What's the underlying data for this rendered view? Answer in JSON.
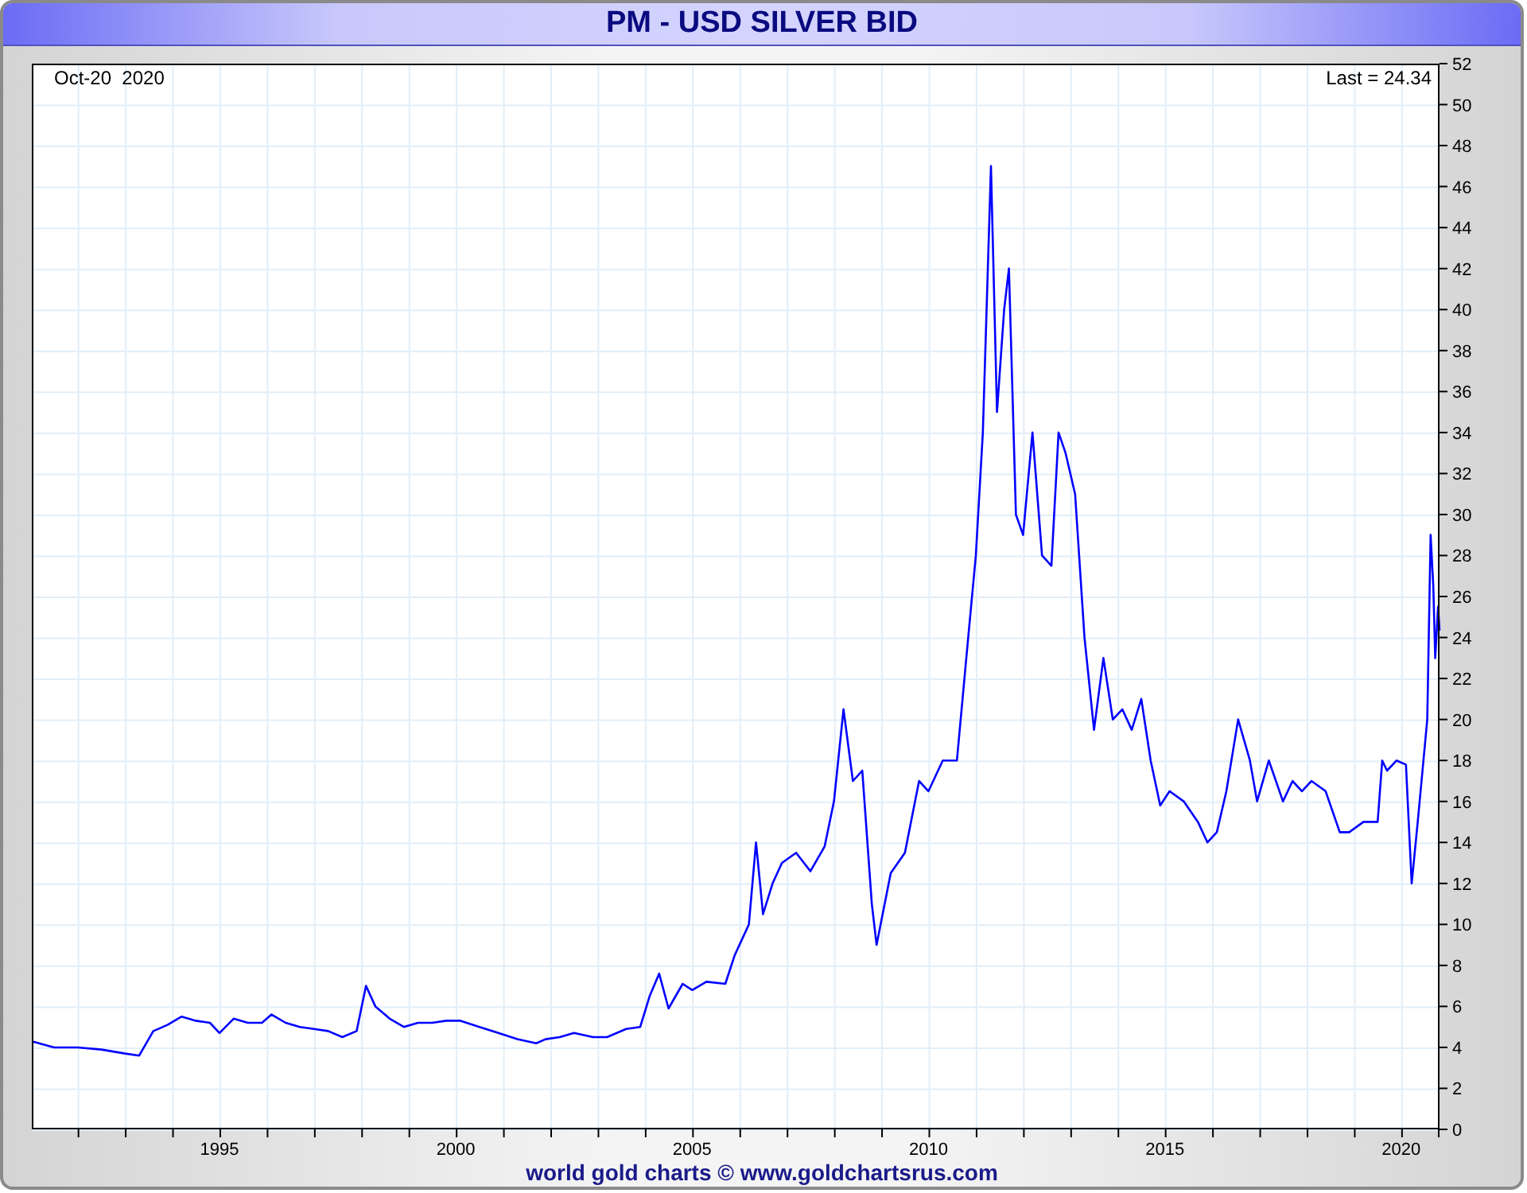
{
  "title": "PM - USD SILVER BID",
  "chart": {
    "date_label": "Oct-20  2020",
    "last_label": "Last = 24.34",
    "chart_data": {
      "type": "line",
      "grid": true,
      "xlim": [
        1991.03,
        2020.81
      ],
      "ylim": [
        0,
        52
      ],
      "xticks": [
        1995,
        2000,
        2005,
        2010,
        2015,
        2020
      ],
      "yticks": [
        0,
        2,
        4,
        6,
        8,
        10,
        12,
        14,
        16,
        18,
        20,
        22,
        24,
        26,
        28,
        30,
        32,
        34,
        36,
        38,
        40,
        42,
        44,
        46,
        48,
        50,
        52
      ],
      "x": [
        1991.03,
        1991.5,
        1992.0,
        1992.5,
        1993.0,
        1993.3,
        1993.6,
        1993.9,
        1994.2,
        1994.5,
        1994.8,
        1995.0,
        1995.3,
        1995.6,
        1995.9,
        1996.1,
        1996.4,
        1996.7,
        1997.0,
        1997.3,
        1997.6,
        1997.9,
        1998.1,
        1998.3,
        1998.6,
        1998.9,
        1999.2,
        1999.5,
        1999.8,
        2000.1,
        2000.5,
        2000.9,
        2001.3,
        2001.7,
        2001.9,
        2002.2,
        2002.5,
        2002.9,
        2003.2,
        2003.6,
        2003.9,
        2004.1,
        2004.3,
        2004.5,
        2004.8,
        2005.0,
        2005.3,
        2005.7,
        2005.9,
        2006.2,
        2006.35,
        2006.5,
        2006.7,
        2006.9,
        2007.2,
        2007.5,
        2007.8,
        2008.0,
        2008.2,
        2008.4,
        2008.6,
        2008.8,
        2008.9,
        2009.2,
        2009.5,
        2009.8,
        2010.0,
        2010.3,
        2010.6,
        2010.8,
        2011.0,
        2011.15,
        2011.32,
        2011.45,
        2011.6,
        2011.7,
        2011.85,
        2012.0,
        2012.2,
        2012.4,
        2012.6,
        2012.75,
        2012.9,
        2013.1,
        2013.3,
        2013.5,
        2013.7,
        2013.9,
        2014.1,
        2014.3,
        2014.5,
        2014.7,
        2014.9,
        2015.1,
        2015.4,
        2015.7,
        2015.9,
        2016.1,
        2016.3,
        2016.55,
        2016.8,
        2016.95,
        2017.2,
        2017.5,
        2017.7,
        2017.9,
        2018.1,
        2018.4,
        2018.7,
        2018.9,
        2019.2,
        2019.5,
        2019.6,
        2019.7,
        2019.9,
        2020.1,
        2020.22,
        2020.35,
        2020.45,
        2020.55,
        2020.62,
        2020.68,
        2020.72,
        2020.78,
        2020.81
      ],
      "series": [
        {
          "color": "#0000ff",
          "values": [
            4.3,
            4.0,
            4.0,
            3.9,
            3.7,
            3.6,
            4.8,
            5.1,
            5.5,
            5.3,
            5.2,
            4.7,
            5.4,
            5.2,
            5.2,
            5.6,
            5.2,
            5.0,
            4.9,
            4.8,
            4.5,
            4.8,
            7.0,
            6.0,
            5.4,
            5.0,
            5.2,
            5.2,
            5.3,
            5.3,
            5.0,
            4.7,
            4.4,
            4.2,
            4.4,
            4.5,
            4.7,
            4.5,
            4.5,
            4.9,
            5.0,
            6.5,
            7.6,
            5.9,
            7.1,
            6.8,
            7.2,
            7.1,
            8.5,
            10.0,
            14.0,
            10.5,
            12.0,
            13.0,
            13.5,
            12.6,
            13.8,
            16.0,
            20.5,
            17.0,
            17.5,
            11.0,
            9.0,
            12.5,
            13.5,
            17.0,
            16.5,
            18.0,
            18.0,
            23.0,
            28.0,
            34.0,
            47.0,
            35.0,
            40.0,
            42.0,
            30.0,
            29.0,
            34.0,
            28.0,
            27.5,
            34.0,
            33.0,
            31.0,
            24.0,
            19.5,
            23.0,
            20.0,
            20.5,
            19.5,
            21.0,
            18.0,
            15.8,
            16.5,
            16.0,
            15.0,
            14.0,
            14.5,
            16.5,
            20.0,
            18.0,
            16.0,
            18.0,
            16.0,
            17.0,
            16.5,
            17.0,
            16.5,
            14.5,
            14.5,
            15.0,
            15.0,
            18.0,
            17.5,
            18.0,
            17.8,
            12.0,
            15.0,
            17.5,
            20.0,
            29.0,
            26.5,
            23.0,
            25.5,
            24.34
          ]
        }
      ]
    }
  },
  "footer": "world gold charts © www.goldchartsrus.com"
}
